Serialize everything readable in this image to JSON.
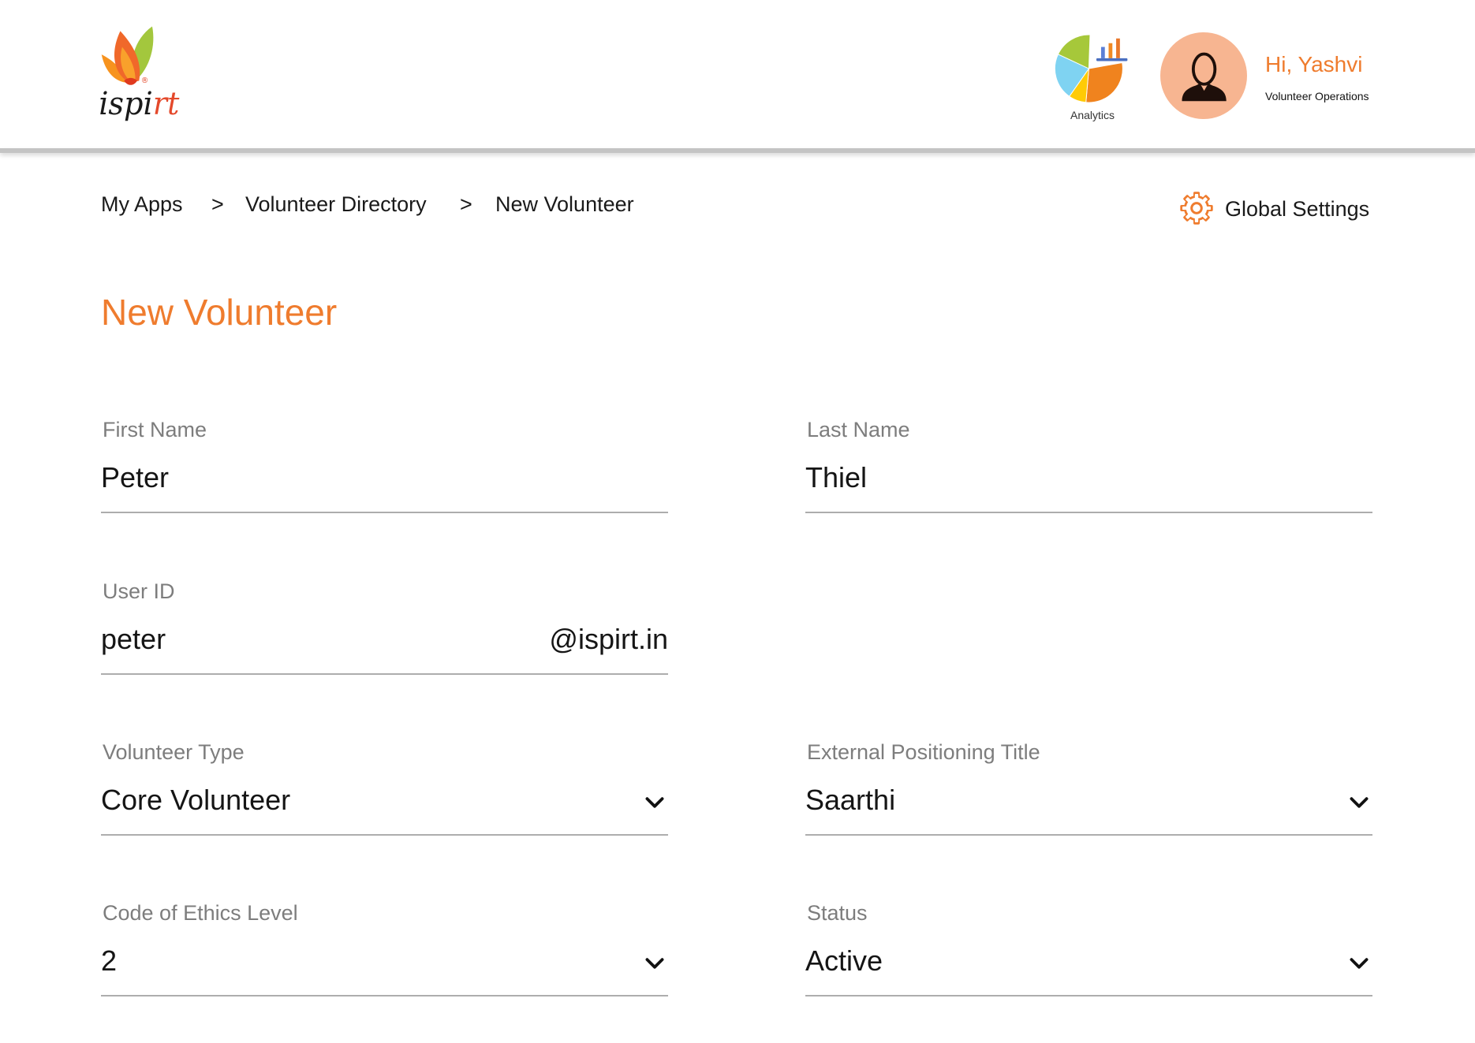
{
  "header": {
    "logo": {
      "text": "ispirt",
      "registered_mark": "®"
    },
    "analytics": {
      "label": "Analytics",
      "icon": "analytics-pie-chart-icon"
    },
    "user": {
      "greeting": "Hi, Yashvi",
      "role": "Volunteer Operations",
      "avatar_icon": "user-silhouette-icon"
    }
  },
  "breadcrumb": {
    "separator": ">",
    "items": [
      "My Apps",
      "Volunteer Directory",
      "New Volunteer"
    ]
  },
  "global_settings": {
    "label": "Global Settings",
    "icon": "gear-icon"
  },
  "page_title": "New Volunteer",
  "form": {
    "first_name": {
      "label": "First Name",
      "value": "Peter"
    },
    "last_name": {
      "label": "Last Name",
      "value": "Thiel"
    },
    "user_id": {
      "label": "User ID",
      "value": "peter",
      "suffix": "@ispirt.in"
    },
    "volunteer_type": {
      "label": "Volunteer Type",
      "value": "Core Volunteer",
      "icon": "chevron-down-icon"
    },
    "external_positioning_title": {
      "label": "External Positioning Title",
      "value": "Saarthi",
      "icon": "chevron-down-icon"
    },
    "code_of_ethics_level": {
      "label": "Code of Ethics Level",
      "value": "2",
      "icon": "chevron-down-icon"
    },
    "status": {
      "label": "Status",
      "value": "Active",
      "icon": "chevron-down-icon"
    }
  },
  "colors": {
    "accent": "#EF7C2E",
    "label_text": "#7D7D7D",
    "value_text": "#151515",
    "underline": "#ADADAD",
    "avatar_background": "#F7B591"
  }
}
